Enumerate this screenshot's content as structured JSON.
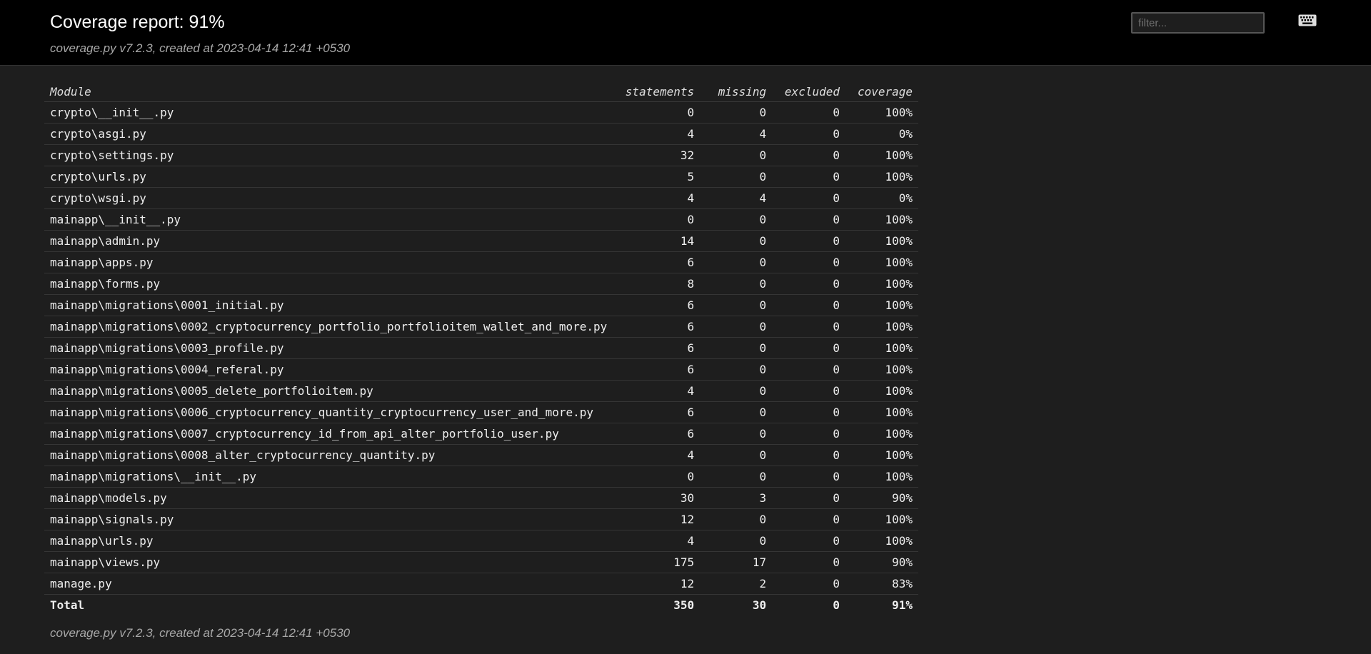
{
  "header": {
    "title": "Coverage report: 91%",
    "meta": "coverage.py v7.2.3, created at 2023-04-14 12:41 +0530",
    "filter_placeholder": "filter...",
    "keyboard_icon": "keyboard-icon"
  },
  "table": {
    "columns": [
      "Module",
      "statements",
      "missing",
      "excluded",
      "coverage"
    ],
    "rows": [
      {
        "name": "crypto\\__init__.py",
        "statements": "0",
        "missing": "0",
        "excluded": "0",
        "coverage": "100%"
      },
      {
        "name": "crypto\\asgi.py",
        "statements": "4",
        "missing": "4",
        "excluded": "0",
        "coverage": "0%"
      },
      {
        "name": "crypto\\settings.py",
        "statements": "32",
        "missing": "0",
        "excluded": "0",
        "coverage": "100%"
      },
      {
        "name": "crypto\\urls.py",
        "statements": "5",
        "missing": "0",
        "excluded": "0",
        "coverage": "100%"
      },
      {
        "name": "crypto\\wsgi.py",
        "statements": "4",
        "missing": "4",
        "excluded": "0",
        "coverage": "0%"
      },
      {
        "name": "mainapp\\__init__.py",
        "statements": "0",
        "missing": "0",
        "excluded": "0",
        "coverage": "100%"
      },
      {
        "name": "mainapp\\admin.py",
        "statements": "14",
        "missing": "0",
        "excluded": "0",
        "coverage": "100%"
      },
      {
        "name": "mainapp\\apps.py",
        "statements": "6",
        "missing": "0",
        "excluded": "0",
        "coverage": "100%"
      },
      {
        "name": "mainapp\\forms.py",
        "statements": "8",
        "missing": "0",
        "excluded": "0",
        "coverage": "100%"
      },
      {
        "name": "mainapp\\migrations\\0001_initial.py",
        "statements": "6",
        "missing": "0",
        "excluded": "0",
        "coverage": "100%"
      },
      {
        "name": "mainapp\\migrations\\0002_cryptocurrency_portfolio_portfolioitem_wallet_and_more.py",
        "statements": "6",
        "missing": "0",
        "excluded": "0",
        "coverage": "100%"
      },
      {
        "name": "mainapp\\migrations\\0003_profile.py",
        "statements": "6",
        "missing": "0",
        "excluded": "0",
        "coverage": "100%"
      },
      {
        "name": "mainapp\\migrations\\0004_referal.py",
        "statements": "6",
        "missing": "0",
        "excluded": "0",
        "coverage": "100%"
      },
      {
        "name": "mainapp\\migrations\\0005_delete_portfolioitem.py",
        "statements": "4",
        "missing": "0",
        "excluded": "0",
        "coverage": "100%"
      },
      {
        "name": "mainapp\\migrations\\0006_cryptocurrency_quantity_cryptocurrency_user_and_more.py",
        "statements": "6",
        "missing": "0",
        "excluded": "0",
        "coverage": "100%"
      },
      {
        "name": "mainapp\\migrations\\0007_cryptocurrency_id_from_api_alter_portfolio_user.py",
        "statements": "6",
        "missing": "0",
        "excluded": "0",
        "coverage": "100%"
      },
      {
        "name": "mainapp\\migrations\\0008_alter_cryptocurrency_quantity.py",
        "statements": "4",
        "missing": "0",
        "excluded": "0",
        "coverage": "100%"
      },
      {
        "name": "mainapp\\migrations\\__init__.py",
        "statements": "0",
        "missing": "0",
        "excluded": "0",
        "coverage": "100%"
      },
      {
        "name": "mainapp\\models.py",
        "statements": "30",
        "missing": "3",
        "excluded": "0",
        "coverage": "90%"
      },
      {
        "name": "mainapp\\signals.py",
        "statements": "12",
        "missing": "0",
        "excluded": "0",
        "coverage": "100%"
      },
      {
        "name": "mainapp\\urls.py",
        "statements": "4",
        "missing": "0",
        "excluded": "0",
        "coverage": "100%"
      },
      {
        "name": "mainapp\\views.py",
        "statements": "175",
        "missing": "17",
        "excluded": "0",
        "coverage": "90%"
      },
      {
        "name": "manage.py",
        "statements": "12",
        "missing": "2",
        "excluded": "0",
        "coverage": "83%"
      }
    ],
    "total": {
      "name": "Total",
      "statements": "350",
      "missing": "30",
      "excluded": "0",
      "coverage": "91%"
    }
  },
  "footer": {
    "meta": "coverage.py v7.2.3, created at 2023-04-14 12:41 +0530"
  },
  "colors": {
    "header_bg": "#000000",
    "page_bg": "#1e1e1e",
    "text": "#eeeeee",
    "muted_text": "#a8a8a8",
    "row_border": "#353535"
  }
}
